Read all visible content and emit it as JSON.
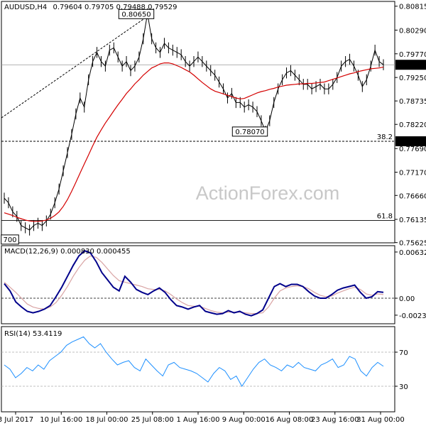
{
  "watermark": "ActionForex.com",
  "header": {
    "symbol": "AUDUSD,H4",
    "ohlc": "0.79604 0.79705 0.79488 0.79529"
  },
  "colors": {
    "price": "#000000",
    "ma": "#d40000",
    "macd": "#00008b",
    "macd_signal": "#d9a4a4",
    "rsi": "#1e90ff",
    "current_price_bg": "#000000"
  },
  "chart_data": [
    {
      "type": "line",
      "panel": "price",
      "title": "AUDUSD,H4",
      "ylim": [
        0.7562,
        0.8092
      ],
      "y_ticks": [
        0.80815,
        0.8029,
        0.7977,
        0.7925,
        0.78735,
        0.7822,
        0.7769,
        0.7717,
        0.7666,
        0.76135,
        0.75625
      ],
      "y_tick_labels": [
        "0.80815",
        "0.80290",
        "0.79770",
        "0.79250",
        "0.78735",
        "0.78220",
        "0.77690",
        "0.77170",
        "0.76660",
        "0.76135",
        "0.75625"
      ],
      "x_tick_labels": [
        "3 Jul 2017",
        "10 Jul 16:00",
        "18 Jul 00:00",
        "25 Jul 08:00",
        "1 Aug 16:00",
        "9 Aug 00:00",
        "16 Aug 08:00",
        "23 Aug 16:00",
        "31 Aug 00:00"
      ],
      "current_price": 0.79529,
      "current_price_label": "0.79529",
      "fib_levels": [
        {
          "label": "38.2",
          "value": 0.7785,
          "value_label": "0.77850"
        },
        {
          "label": "61.8",
          "value": 0.7611,
          "value_label": ""
        }
      ],
      "annotations": [
        {
          "text": "0.80650",
          "value": 0.8065
        },
        {
          "text": "0.78070",
          "value": 0.7807
        },
        {
          "text": "700",
          "value": 0.757
        }
      ],
      "series": [
        {
          "key": "close",
          "values": [
            0.766,
            0.765,
            0.763,
            0.762,
            0.76,
            0.7595,
            0.759,
            0.76,
            0.7605,
            0.76,
            0.761,
            0.7625,
            0.765,
            0.768,
            0.772,
            0.776,
            0.78,
            0.7845,
            0.788,
            0.786,
            0.792,
            0.796,
            0.798,
            0.796,
            0.795,
            0.7985,
            0.799,
            0.797,
            0.795,
            0.796,
            0.794,
            0.795,
            0.797,
            0.801,
            0.8065,
            0.801,
            0.799,
            0.798,
            0.8,
            0.799,
            0.7985,
            0.798,
            0.7975,
            0.796,
            0.795,
            0.796,
            0.797,
            0.796,
            0.795,
            0.794,
            0.793,
            0.7915,
            0.79,
            0.788,
            0.789,
            0.787,
            0.787,
            0.786,
            0.7865,
            0.786,
            0.785,
            0.783,
            0.7807,
            0.783,
            0.787,
            0.79,
            0.792,
            0.7935,
            0.794,
            0.793,
            0.792,
            0.791,
            0.791,
            0.79,
            0.7905,
            0.791,
            0.79,
            0.79,
            0.791,
            0.7925,
            0.795,
            0.796,
            0.7965,
            0.795,
            0.793,
            0.7905,
            0.792,
            0.795,
            0.7985,
            0.796,
            0.7953
          ]
        },
        {
          "key": "ma",
          "values": [
            0.7628,
            0.7625,
            0.7622,
            0.7618,
            0.7615,
            0.7612,
            0.761,
            0.7609,
            0.7609,
            0.761,
            0.7612,
            0.7616,
            0.7622,
            0.763,
            0.7642,
            0.7657,
            0.7675,
            0.7695,
            0.7715,
            0.7735,
            0.7755,
            0.7775,
            0.7794,
            0.781,
            0.7825,
            0.7838,
            0.7852,
            0.7865,
            0.7877,
            0.789,
            0.79,
            0.7911,
            0.792,
            0.793,
            0.7938,
            0.7946,
            0.795,
            0.7955,
            0.7957,
            0.7957,
            0.7955,
            0.7951,
            0.7947,
            0.7942,
            0.7937,
            0.793,
            0.7922,
            0.7914,
            0.7907,
            0.79,
            0.7895,
            0.7892,
            0.7889,
            0.7886,
            0.7883,
            0.788,
            0.7878,
            0.7879,
            0.7883,
            0.7887,
            0.7891,
            0.7894,
            0.7896,
            0.7899,
            0.7901,
            0.7904,
            0.7906,
            0.7908,
            0.7909,
            0.791,
            0.7911,
            0.7911,
            0.7912,
            0.7912,
            0.7913,
            0.7914,
            0.7915,
            0.7918,
            0.7921,
            0.7924,
            0.7927,
            0.793,
            0.7933,
            0.7935,
            0.7938,
            0.794,
            0.7942,
            0.7944,
            0.7945,
            0.7946,
            0.7948
          ]
        }
      ]
    },
    {
      "type": "line",
      "panel": "macd",
      "title": "MACD(12,26,9) 0.000830 0.000455",
      "ylim": [
        -0.0035,
        0.0072
      ],
      "y_ticks": [
        0.006329,
        0.0,
        -0.002324
      ],
      "y_tick_labels": [
        "0.006329",
        "0.00",
        "-0.002324"
      ],
      "series": [
        {
          "key": "macd",
          "values": [
            0.002,
            0.001,
            -0.0005,
            -0.0012,
            -0.0018,
            -0.002,
            -0.0018,
            -0.0015,
            -0.001,
            0.0002,
            0.0015,
            0.003,
            0.0045,
            0.0058,
            0.0065,
            0.0062,
            0.005,
            0.0035,
            0.0025,
            0.0015,
            0.001,
            0.003,
            0.0022,
            0.0012,
            0.0008,
            0.0005,
            0.001,
            0.0014,
            0.0008,
            -0.0002,
            -0.001,
            -0.0012,
            -0.0015,
            -0.0012,
            -0.001,
            -0.0018,
            -0.002,
            -0.0022,
            -0.0021,
            -0.0017,
            -0.002,
            -0.0018,
            -0.0022,
            -0.0024,
            -0.0021,
            -0.0016,
            0.0,
            0.0016,
            0.002,
            0.0016,
            0.0019,
            0.0019,
            0.0016,
            0.0009,
            0.0003,
            0.0,
            0.0,
            0.0005,
            0.0011,
            0.0014,
            0.0016,
            0.0018,
            0.0008,
            0.0,
            0.0002,
            0.0009,
            0.0008
          ]
        },
        {
          "key": "signal",
          "values": [
            0.0022,
            0.0015,
            0.0008,
            0.0,
            -0.0008,
            -0.0012,
            -0.0014,
            -0.0015,
            -0.0012,
            -0.0006,
            0.0004,
            0.0016,
            0.003,
            0.0042,
            0.0052,
            0.0058,
            0.0056,
            0.0049,
            0.004,
            0.0031,
            0.0024,
            0.0022,
            0.002,
            0.0018,
            0.0016,
            0.0013,
            0.0012,
            0.0012,
            0.001,
            0.0005,
            -0.0001,
            -0.0006,
            -0.001,
            -0.0011,
            -0.0011,
            -0.0014,
            -0.0017,
            -0.0019,
            -0.002,
            -0.0019,
            -0.0019,
            -0.0019,
            -0.002,
            -0.0021,
            -0.0021,
            -0.002,
            -0.0012,
            0.0,
            0.001,
            0.0014,
            0.0016,
            0.0017,
            0.0016,
            0.0013,
            0.0008,
            0.0004,
            0.0002,
            0.0003,
            0.0007,
            0.001,
            0.0013,
            0.0015,
            0.0012,
            0.0006,
            0.0004,
            0.0006,
            0.0005
          ]
        }
      ]
    },
    {
      "type": "line",
      "panel": "rsi",
      "title": "RSI(14) 53.4119",
      "ylim": [
        0,
        100
      ],
      "y_ticks": [
        70,
        30
      ],
      "y_tick_labels": [
        "70",
        "30"
      ],
      "levels": [
        70,
        30
      ],
      "series": [
        {
          "key": "rsi",
          "values": [
            55,
            50,
            40,
            45,
            52,
            48,
            55,
            50,
            60,
            65,
            70,
            78,
            82,
            85,
            88,
            80,
            75,
            80,
            70,
            62,
            55,
            58,
            60,
            52,
            48,
            62,
            55,
            48,
            42,
            55,
            58,
            52,
            50,
            48,
            45,
            40,
            35,
            45,
            52,
            48,
            38,
            42,
            30,
            40,
            50,
            58,
            62,
            55,
            52,
            48,
            55,
            52,
            58,
            52,
            50,
            48,
            55,
            58,
            62,
            52,
            55,
            65,
            62,
            48,
            42,
            52,
            58,
            53.4
          ]
        }
      ]
    }
  ]
}
